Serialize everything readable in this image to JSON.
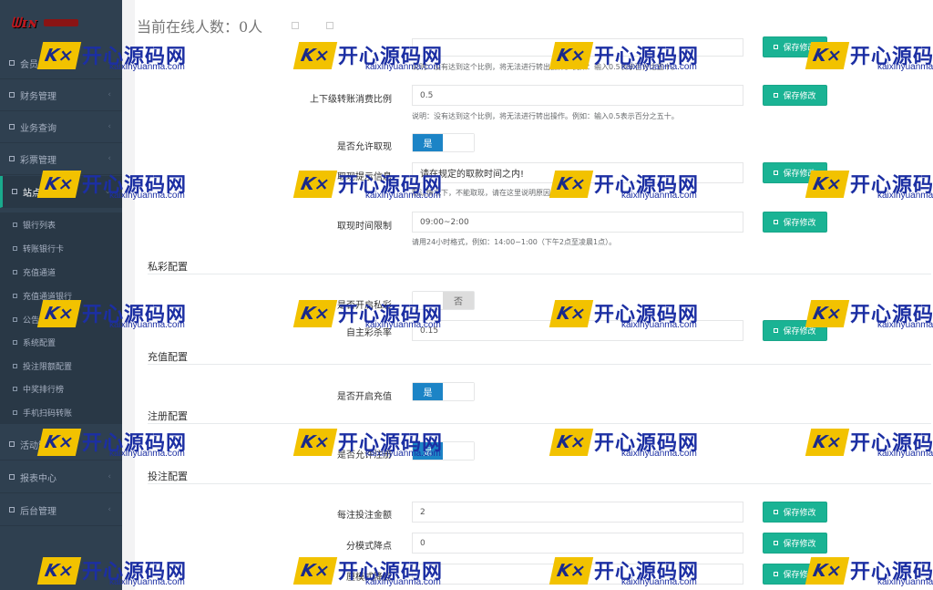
{
  "topbar": {
    "online_label": "当前在线人数：0人"
  },
  "sidebar": {
    "logo_text": "ᗯɪɴ",
    "menu": [
      {
        "label": "会员管理"
      },
      {
        "label": "财务管理"
      },
      {
        "label": "业务查询"
      },
      {
        "label": "彩票管理"
      },
      {
        "label": "站点维护"
      },
      {
        "label": "活动管理"
      },
      {
        "label": "报表中心"
      },
      {
        "label": "后台管理"
      }
    ],
    "submenu": [
      {
        "label": "银行列表"
      },
      {
        "label": "转账银行卡"
      },
      {
        "label": "充值通道"
      },
      {
        "label": "充值通道银行"
      },
      {
        "label": "公告管理"
      },
      {
        "label": "系统配置"
      },
      {
        "label": "投注限额配置"
      },
      {
        "label": "中奖排行榜"
      },
      {
        "label": "手机扫码转账"
      }
    ]
  },
  "form": {
    "row0": {
      "hint": "说明：没有达到这个比例，将无法进行转出操作。例如：输入0.5表示百分之五十。",
      "save": "保存修改"
    },
    "row1": {
      "label": "上下级转账消费比例",
      "value": "0.5",
      "hint": "说明：没有达到这个比例，将无法进行转出操作。例如：输入0.5表示百分之五十。",
      "save": "保存修改"
    },
    "row2": {
      "label": "是否允许取现",
      "on": "是",
      "off": ""
    },
    "row3": {
      "label": "取现提示信息",
      "value": "请在规定的取款时间之内!",
      "hint": "默认情况下，不能取现，请在这里说明原因。",
      "save": "保存修改"
    },
    "row4": {
      "label": "取现时间限制",
      "value": "09:00~2:00",
      "hint": "请用24小时格式，例如：14:00~1:00（下午2点至凌晨1点）。",
      "save": "保存修改"
    },
    "section_private": "私彩配置",
    "row5": {
      "label": "是否开启私彩",
      "on": "",
      "off": "否"
    },
    "row6": {
      "label": "自主彩杀率",
      "value": "0.15",
      "save": "保存修改"
    },
    "section_recharge": "充值配置",
    "row7": {
      "label": "是否开启充值",
      "on": "是",
      "off": ""
    },
    "section_register": "注册配置",
    "row8": {
      "label": "是否允许注册",
      "on": "是",
      "off": ""
    },
    "section_bet": "投注配置",
    "row9": {
      "label": "每注投注金额",
      "value": "2",
      "save": "保存修改"
    },
    "row10": {
      "label": "分模式降点",
      "value": "0",
      "save": "保存修改"
    },
    "row11": {
      "label": "厘模式降点",
      "value": "",
      "save": "保存修改"
    }
  },
  "watermark": {
    "k": "K",
    "cn": "开心源码网",
    "en": "kaixinyuanma.com"
  },
  "colors": {
    "sidebar": "#2f4050",
    "save_button": "#1ab394",
    "toggle_on": "#1c84c6"
  }
}
